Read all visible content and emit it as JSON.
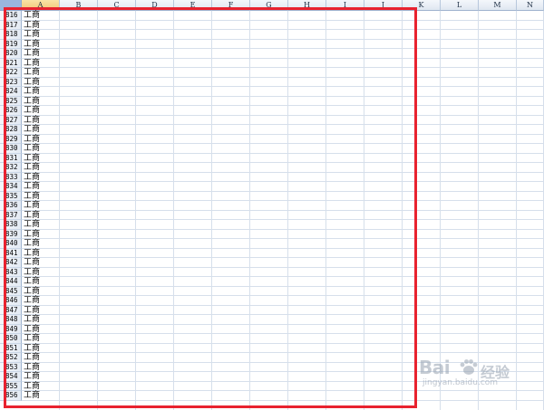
{
  "columns": [
    "A",
    "B",
    "C",
    "D",
    "E",
    "F",
    "G",
    "H",
    "I",
    "J",
    "K",
    "L",
    "M",
    "N"
  ],
  "selected_column": "A",
  "rows": [
    {
      "num": "816",
      "a": "工商"
    },
    {
      "num": "817",
      "a": "工商"
    },
    {
      "num": "818",
      "a": "工商"
    },
    {
      "num": "819",
      "a": "工商"
    },
    {
      "num": "820",
      "a": "工商"
    },
    {
      "num": "821",
      "a": "工商"
    },
    {
      "num": "822",
      "a": "工商"
    },
    {
      "num": "823",
      "a": "工商"
    },
    {
      "num": "824",
      "a": "工商"
    },
    {
      "num": "825",
      "a": "工商"
    },
    {
      "num": "826",
      "a": "工商"
    },
    {
      "num": "827",
      "a": "工商"
    },
    {
      "num": "828",
      "a": "工商"
    },
    {
      "num": "829",
      "a": "工商"
    },
    {
      "num": "830",
      "a": "工商"
    },
    {
      "num": "831",
      "a": "工商"
    },
    {
      "num": "832",
      "a": "工商"
    },
    {
      "num": "833",
      "a": "工商"
    },
    {
      "num": "834",
      "a": "工商"
    },
    {
      "num": "835",
      "a": "工商"
    },
    {
      "num": "836",
      "a": "工商"
    },
    {
      "num": "837",
      "a": "工商"
    },
    {
      "num": "838",
      "a": "工商"
    },
    {
      "num": "839",
      "a": "工商"
    },
    {
      "num": "840",
      "a": "工商"
    },
    {
      "num": "841",
      "a": "工商"
    },
    {
      "num": "842",
      "a": "工商"
    },
    {
      "num": "843",
      "a": "工商"
    },
    {
      "num": "844",
      "a": "工商"
    },
    {
      "num": "845",
      "a": "工商"
    },
    {
      "num": "846",
      "a": "工商"
    },
    {
      "num": "847",
      "a": "工商"
    },
    {
      "num": "848",
      "a": "工商"
    },
    {
      "num": "849",
      "a": "工商"
    },
    {
      "num": "850",
      "a": "工商"
    },
    {
      "num": "851",
      "a": "工商"
    },
    {
      "num": "852",
      "a": "工商"
    },
    {
      "num": "853",
      "a": "工商"
    },
    {
      "num": "854",
      "a": "工商"
    },
    {
      "num": "855",
      "a": "工商"
    },
    {
      "num": "856",
      "a": "工商"
    }
  ],
  "highlight": {
    "color": "#e8222f"
  },
  "watermark": {
    "brand": "Bai",
    "product": "经验",
    "url": "jingyan.baidu.com"
  }
}
